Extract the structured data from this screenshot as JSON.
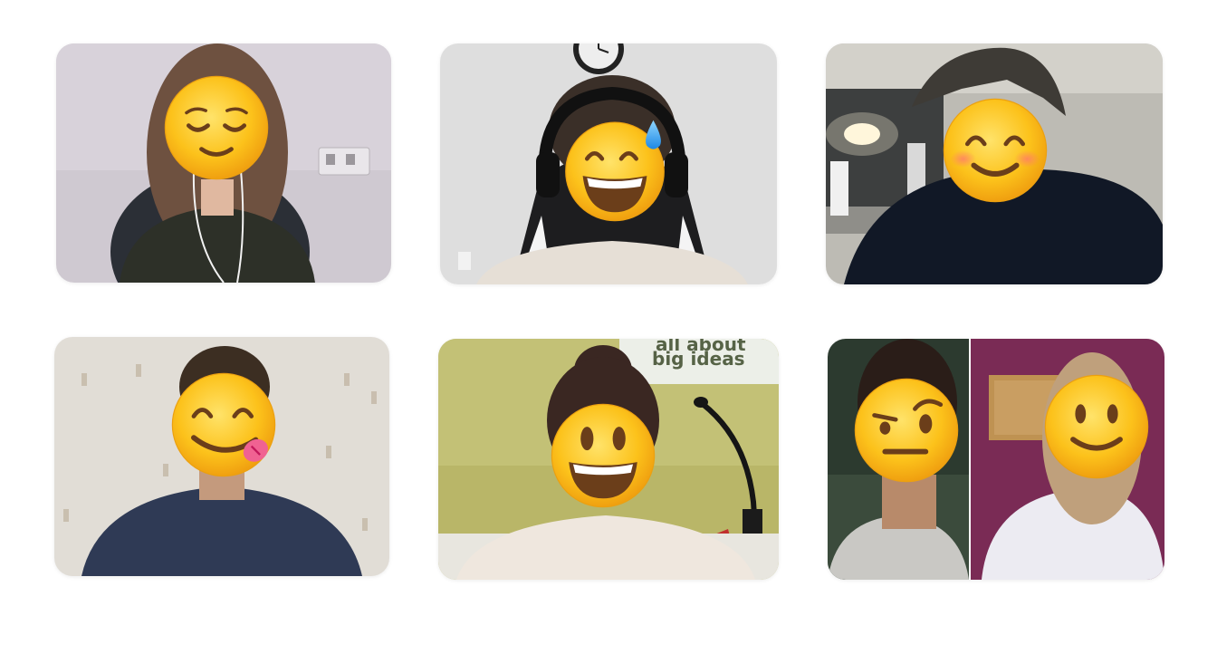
{
  "participants": [
    {
      "label": "participant-1",
      "emoji": "relieved-face-icon"
    },
    {
      "label": "participant-2",
      "emoji": "grinning-face-with-sweat-icon"
    },
    {
      "label": "participant-3",
      "emoji": "smiling-face-with-smiling-eyes-icon"
    },
    {
      "label": "participant-4",
      "emoji": "face-savoring-food-icon"
    },
    {
      "label": "participant-5",
      "emoji": "grinning-face-with-big-eyes-icon"
    },
    {
      "label": "participant-6a",
      "emoji": "face-with-raised-eyebrow-icon"
    },
    {
      "label": "participant-6b",
      "emoji": "slightly-smiling-face-icon"
    }
  ],
  "background_poster": {
    "line1": "all about",
    "line2": "big ideas"
  },
  "colors": {
    "emoji_yellow": "#fcc21b",
    "emoji_outline": "#e59600",
    "page_bg": "#ffffff"
  }
}
